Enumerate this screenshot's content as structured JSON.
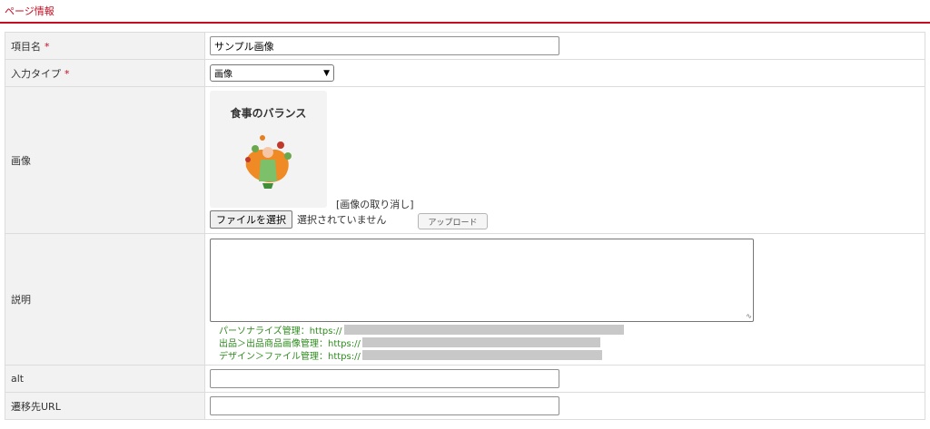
{
  "header": {
    "title": "ページ情報"
  },
  "colors": {
    "accent": "#c30d23",
    "help_text": "#2e8b1e",
    "label_bg": "#f2f2f2"
  },
  "rows": {
    "item_name": {
      "label": "項目名",
      "required_mark": "*",
      "value": "サンプル画像"
    },
    "input_type": {
      "label": "入力タイプ",
      "required_mark": "*",
      "selected": "画像",
      "icon": "chevron-down-icon"
    },
    "image": {
      "label": "画像",
      "thumbnail_title": "食事のバランス",
      "thumbnail_icon": "food-balance-illustration",
      "remove_link": "[画像の取り消し]",
      "file_button": "ファイルを選択",
      "no_file_text": "選択されていません",
      "upload_button": "アップロード"
    },
    "description": {
      "label": "説明",
      "value": "",
      "help_lines": [
        "パーソナライズ管理：https://",
        "出品＞出品商品画像管理：https://",
        "デザイン＞ファイル管理：https://"
      ]
    },
    "alt": {
      "label": "alt",
      "value": ""
    },
    "link_url": {
      "label": "遷移先URL",
      "value": ""
    }
  }
}
